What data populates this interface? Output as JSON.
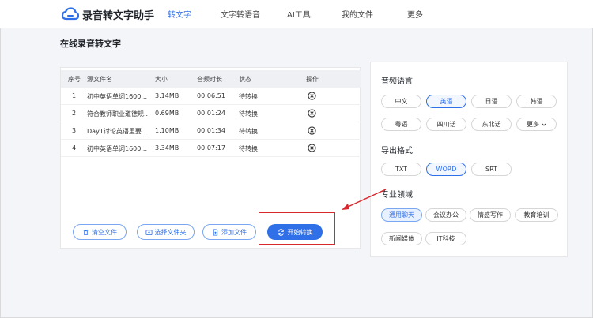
{
  "header": {
    "brand": "录音转文字助手",
    "nav": [
      "转文字",
      "文字转语音",
      "AI工具",
      "我的文件",
      "更多"
    ],
    "active_nav": 0
  },
  "page_title": "在线录音转文字",
  "table": {
    "columns": [
      "序号",
      "源文件名",
      "大小",
      "音频时长",
      "状态",
      "操作"
    ],
    "rows": [
      {
        "index": "1",
        "name": "初中英语单词1600...",
        "size": "3.14MB",
        "duration": "00:06:51",
        "status": "待转换"
      },
      {
        "index": "2",
        "name": "符合教师职业道德规...",
        "size": "0.69MB",
        "duration": "00:01:24",
        "status": "待转换"
      },
      {
        "index": "3",
        "name": "Day1讨论英语重要...",
        "size": "1.10MB",
        "duration": "00:01:34",
        "status": "待转换"
      },
      {
        "index": "4",
        "name": "初中英语单词1600...",
        "size": "3.34MB",
        "duration": "00:07:17",
        "status": "待转换"
      }
    ]
  },
  "actions": {
    "clear": "清空文件",
    "choose_folder": "选择文件夹",
    "add_file": "添加文件",
    "start": "开始转换"
  },
  "settings": {
    "language_title": "音频语言",
    "languages": [
      "中文",
      "英语",
      "日语",
      "韩语",
      "粤语",
      "四川话",
      "东北话",
      "更多"
    ],
    "selected_language": "英语",
    "format_title": "导出格式",
    "formats": [
      "TXT",
      "WORD",
      "SRT"
    ],
    "selected_format": "WORD",
    "domain_title": "专业领域",
    "domains": [
      "通用聊天",
      "会议办公",
      "情感写作",
      "教育培训",
      "新闻媒体",
      "IT科技"
    ],
    "selected_domain": "通用聊天"
  },
  "colors": {
    "accent": "#2f6fe8",
    "annotation": "#d9262b"
  }
}
